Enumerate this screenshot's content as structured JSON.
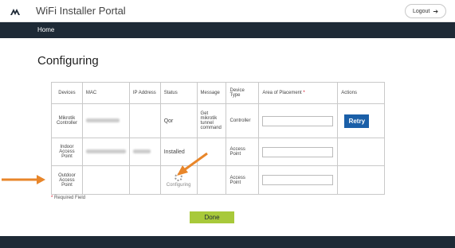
{
  "app": {
    "title": "WiFi Installer Portal",
    "logout_label": "Logout"
  },
  "nav": {
    "home": "Home"
  },
  "page": {
    "title": "Configuring"
  },
  "table": {
    "headers": [
      "Devices",
      "MAC",
      "IP Address",
      "Status",
      "Message",
      "Device Type",
      "Area of Placement",
      "Actions"
    ],
    "rows": [
      {
        "device": "Mikrotik Controller",
        "status": "Qor",
        "message": "Get mikrotik tunnel command",
        "type": "Controller",
        "action": "Retry"
      },
      {
        "device": "Indoor Access Point",
        "status": "Installed",
        "message": "",
        "type": "Access Point",
        "action": ""
      },
      {
        "device": "Outdoor Access Point",
        "status": "Configuring",
        "message": "",
        "type": "Access Point",
        "action": ""
      }
    ]
  },
  "required_note": "Required Field",
  "done_label": "Done",
  "colors": {
    "navbar": "#1e2a36",
    "retry": "#1a5fa8",
    "done": "#a8c93a",
    "annotation": "#e8862a"
  }
}
